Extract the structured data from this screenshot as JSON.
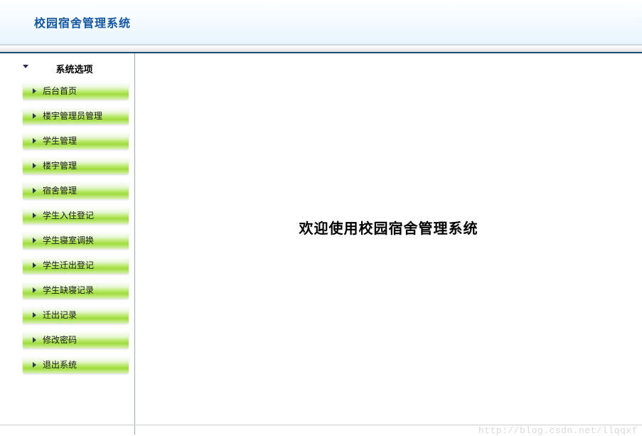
{
  "header": {
    "title": "校园宿舍管理系统"
  },
  "sidebar": {
    "title": "系统选项",
    "items": [
      {
        "label": "后台首页"
      },
      {
        "label": "楼宇管理员管理"
      },
      {
        "label": "学生管理"
      },
      {
        "label": "楼宇管理"
      },
      {
        "label": "宿舍管理"
      },
      {
        "label": "学生入住登记"
      },
      {
        "label": "学生寝室调换"
      },
      {
        "label": "学生迁出登记"
      },
      {
        "label": "学生缺寝记录"
      },
      {
        "label": "迁出记录"
      },
      {
        "label": "修改密码"
      },
      {
        "label": "退出系统"
      }
    ]
  },
  "main": {
    "welcome": "欢迎使用校园宿舍管理系统"
  },
  "watermark": "http://blog.csdn.net/llqqxf"
}
